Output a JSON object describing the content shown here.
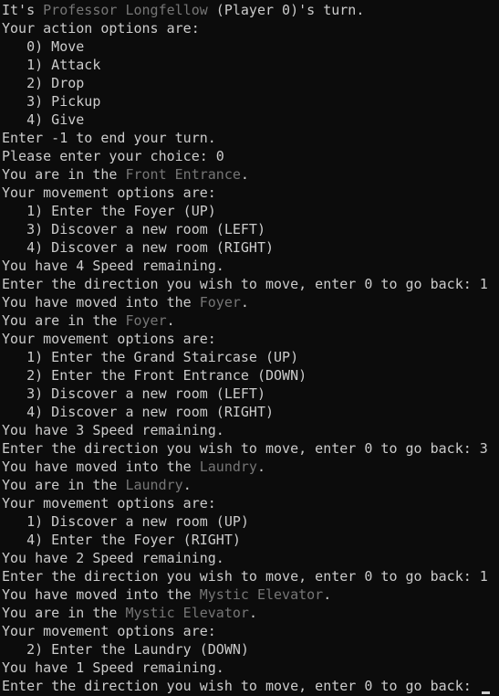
{
  "colors": {
    "background": "#0c0c0c",
    "text": "#cccccc",
    "highlight": "#767676"
  },
  "lines": [
    [
      {
        "t": "It's "
      },
      {
        "t": "Professor Longfellow",
        "h": true
      },
      {
        "t": " (Player 0)'s turn."
      }
    ],
    [
      {
        "t": "Your action options are:"
      }
    ],
    [
      {
        "t": "   0) Move"
      }
    ],
    [
      {
        "t": "   1) Attack"
      }
    ],
    [
      {
        "t": "   2) Drop"
      }
    ],
    [
      {
        "t": "   3) Pickup"
      }
    ],
    [
      {
        "t": "   4) Give"
      }
    ],
    [
      {
        "t": "Enter -1 to end your turn."
      }
    ],
    [
      {
        "t": "Please enter your choice: 0"
      }
    ],
    [
      {
        "t": "You are in the "
      },
      {
        "t": "Front Entrance",
        "h": true
      },
      {
        "t": "."
      }
    ],
    [
      {
        "t": "Your movement options are:"
      }
    ],
    [
      {
        "t": "   1) Enter the Foyer (UP)"
      }
    ],
    [
      {
        "t": "   3) Discover a new room (LEFT)"
      }
    ],
    [
      {
        "t": "   4) Discover a new room (RIGHT)"
      }
    ],
    [
      {
        "t": "You have 4 Speed remaining."
      }
    ],
    [
      {
        "t": "Enter the direction you wish to move, enter 0 to go back: 1"
      }
    ],
    [
      {
        "t": "You have moved into the "
      },
      {
        "t": "Foyer",
        "h": true
      },
      {
        "t": "."
      }
    ],
    [
      {
        "t": "You are in the "
      },
      {
        "t": "Foyer",
        "h": true
      },
      {
        "t": "."
      }
    ],
    [
      {
        "t": "Your movement options are:"
      }
    ],
    [
      {
        "t": "   1) Enter the Grand Staircase (UP)"
      }
    ],
    [
      {
        "t": "   2) Enter the Front Entrance (DOWN)"
      }
    ],
    [
      {
        "t": "   3) Discover a new room (LEFT)"
      }
    ],
    [
      {
        "t": "   4) Discover a new room (RIGHT)"
      }
    ],
    [
      {
        "t": "You have 3 Speed remaining."
      }
    ],
    [
      {
        "t": "Enter the direction you wish to move, enter 0 to go back: 3"
      }
    ],
    [
      {
        "t": "You have moved into the "
      },
      {
        "t": "Laundry",
        "h": true
      },
      {
        "t": "."
      }
    ],
    [
      {
        "t": "You are in the "
      },
      {
        "t": "Laundry",
        "h": true
      },
      {
        "t": "."
      }
    ],
    [
      {
        "t": "Your movement options are:"
      }
    ],
    [
      {
        "t": "   1) Discover a new room (UP)"
      }
    ],
    [
      {
        "t": "   4) Enter the Foyer (RIGHT)"
      }
    ],
    [
      {
        "t": "You have 2 Speed remaining."
      }
    ],
    [
      {
        "t": "Enter the direction you wish to move, enter 0 to go back: 1"
      }
    ],
    [
      {
        "t": "You have moved into the "
      },
      {
        "t": "Mystic Elevator",
        "h": true
      },
      {
        "t": "."
      }
    ],
    [
      {
        "t": "You are in the "
      },
      {
        "t": "Mystic Elevator",
        "h": true
      },
      {
        "t": "."
      }
    ],
    [
      {
        "t": "Your movement options are:"
      }
    ],
    [
      {
        "t": "   2) Enter the Laundry (DOWN)"
      }
    ],
    [
      {
        "t": "You have 1 Speed remaining."
      }
    ],
    [
      {
        "t": "Enter the direction you wish to move, enter 0 to go back: "
      }
    ]
  ]
}
